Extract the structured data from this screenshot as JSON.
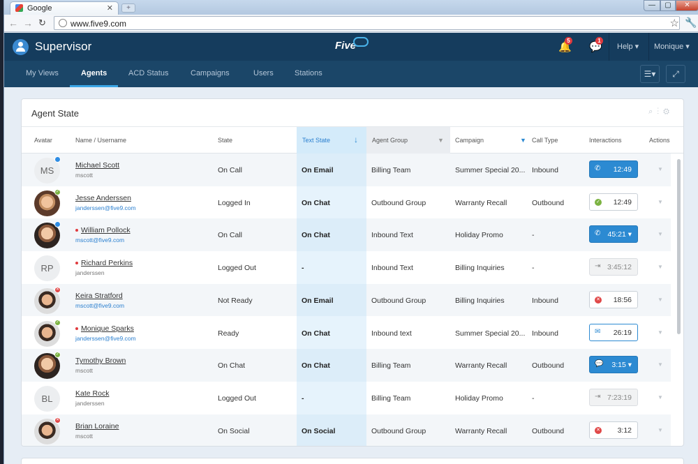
{
  "browser": {
    "tab_title": "Google",
    "tab_close": "✕",
    "new_tab": "+",
    "url": "www.five9.com",
    "win_min": "—",
    "win_max": "▢",
    "win_close": "✕"
  },
  "header": {
    "title": "Supervisor",
    "logo_text": "Five",
    "notifications_count": "5",
    "messages_count": "1",
    "help_label": "Help ▾",
    "user_label": "Monique ▾"
  },
  "nav": {
    "items": [
      {
        "label": "My Views"
      },
      {
        "label": "Agents"
      },
      {
        "label": "ACD Status"
      },
      {
        "label": "Campaigns"
      },
      {
        "label": "Users"
      },
      {
        "label": "Stations"
      }
    ],
    "active": "Agents"
  },
  "card": {
    "title": "Agent State",
    "columns": {
      "avatar": "Avatar",
      "name": "Name  /  Username",
      "state": "State",
      "text_state": "Text State",
      "agent_group": "Agent Group",
      "campaign": "Campaign",
      "call_type": "Call Type",
      "interactions": "Interactions",
      "actions": "Actions"
    },
    "rows": [
      {
        "initials": "MS",
        "name": "Michael Scott",
        "username": "mscott",
        "state": "On Call",
        "text_state": "On Email",
        "agent_group": "Billing Team",
        "campaign": "Summer Special 20...",
        "call_type": "Inbound",
        "interaction_time": "12:49"
      },
      {
        "initials": "",
        "name": "Jesse Anderssen",
        "username": "janderssen@five9.com",
        "state": "Logged In",
        "text_state": "On Chat",
        "agent_group": "Outbound Group",
        "campaign": "Warranty Recall",
        "call_type": "Outbound",
        "interaction_time": "12:49"
      },
      {
        "initials": "",
        "name": "William Pollock",
        "username": "mscott@five9.com",
        "state": "On Call",
        "text_state": "On Chat",
        "agent_group": "Inbound Text",
        "campaign": "Holiday Promo",
        "call_type": "-",
        "interaction_time": "45:21 ▾"
      },
      {
        "initials": "RP",
        "name": "Richard Perkins",
        "username": "janderssen",
        "state": "Logged Out",
        "text_state": "-",
        "agent_group": "Inbound Text",
        "campaign": "Billing Inquiries",
        "call_type": "-",
        "interaction_time": "3:45:12"
      },
      {
        "initials": "",
        "name": "Keira Stratford",
        "username": "mscott@five9.com",
        "state": "Not Ready",
        "text_state": "On Email",
        "agent_group": "Outbound Group",
        "campaign": "Billing Inquiries",
        "call_type": "Inbound",
        "interaction_time": "18:56"
      },
      {
        "initials": "",
        "name": "Monique Sparks",
        "username": "janderssen@five9.com",
        "state": "Ready",
        "text_state": "On Chat",
        "agent_group": "Inbound text",
        "campaign": "Summer Special 20...",
        "call_type": "Inbound",
        "interaction_time": "26:19"
      },
      {
        "initials": "",
        "name": "Tymothy Brown",
        "username": "mscott",
        "state": "On Chat",
        "text_state": "On Chat",
        "agent_group": "Billing Team",
        "campaign": "Warranty Recall",
        "call_type": "Outbound",
        "interaction_time": "3:15 ▾"
      },
      {
        "initials": "BL",
        "name": "Kate Rock",
        "username": "janderssen",
        "state": "Logged Out",
        "text_state": "-",
        "agent_group": "Billing Team",
        "campaign": "Holiday Promo",
        "call_type": "-",
        "interaction_time": "7:23:19"
      },
      {
        "initials": "",
        "name": "Brian Loraine",
        "username": "mscott",
        "state": "On Social",
        "text_state": "On Social",
        "agent_group": "Outbound Group",
        "campaign": "Warranty Recall",
        "call_type": "Outbound",
        "interaction_time": "3:12"
      }
    ]
  },
  "colors": {
    "header_bg": "#153c5d",
    "nav_bg": "#1b4668",
    "accent": "#2c8ad2",
    "sorted_column_bg": "#e6f3fc"
  }
}
